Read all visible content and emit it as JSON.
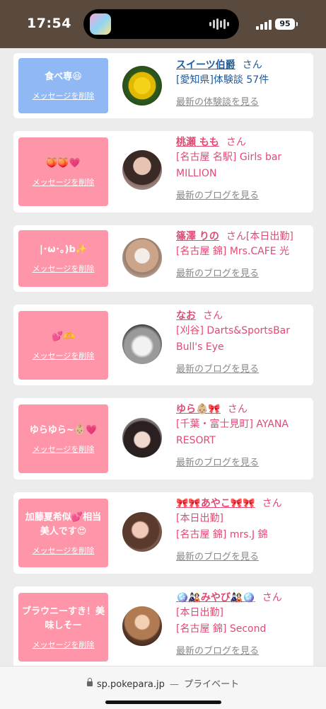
{
  "status_bar": {
    "time": "17:54",
    "battery": "95"
  },
  "cards": [
    {
      "bubble_color": "blue",
      "message": "食べ専😆",
      "delete_label": "メッセージを削除",
      "name": "スイーツ伯爵",
      "honorific": "さん",
      "name_extra": "",
      "lines": [
        "[愛知県]体験談 57件"
      ],
      "link": "最新の体験談を見る",
      "avatar": "yellow-flower"
    },
    {
      "bubble_color": "pink",
      "message": "🍑🍑💗",
      "delete_label": "メッセージを削除",
      "name": "桃瀬 もも",
      "honorific": "さん",
      "name_extra": "",
      "lines": [
        "[名古屋 名駅] Girls bar",
        "MILLION"
      ],
      "link": "最新のブログを見る",
      "avatar": "girl-dark-hair"
    },
    {
      "bubble_color": "pink",
      "message": "|･ω･｡)b✨",
      "delete_label": "メッセージを削除",
      "name": "篠澤 りの",
      "honorific": "さん",
      "name_extra": "[本日出勤]",
      "lines": [
        "[名古屋 錦] Mrs.CAFE 光"
      ],
      "link": "最新のブログを見る",
      "avatar": "girl-light-hair"
    },
    {
      "bubble_color": "pink",
      "message": "💕🫶",
      "delete_label": "メッセージを削除",
      "name": "なお",
      "honorific": "さん",
      "name_extra": "",
      "lines": [
        "[刈谷] Darts&SportsBar",
        "Bull's Eye"
      ],
      "link": "最新のブログを見る",
      "avatar": "bw-closeup"
    },
    {
      "bubble_color": "pink",
      "message": "ゆらゆら~👶🏼💗",
      "delete_label": "メッセージを削除",
      "name": "ゆら👶🏼🎀",
      "honorific": "さん",
      "name_extra": "",
      "lines": [
        "[千葉・富士見町] AYANA",
        "RESORT"
      ],
      "link": "最新のブログを見る",
      "avatar": "girl-bunny-ears"
    },
    {
      "bubble_color": "pink",
      "message": "加藤夏希似💕相当美人です😍",
      "delete_label": "メッセージを削除",
      "name": "🎀🎀あやこ🎀🎀",
      "honorific": "さん",
      "name_extra": "",
      "lines": [
        "[本日出勤]",
        "[名古屋 錦] mrs.J 錦"
      ],
      "link": "最新のブログを見る",
      "avatar": "girl-brown-hair"
    },
    {
      "bubble_color": "pink",
      "message": "ブラウニーすき！美味しそー",
      "delete_label": "メッセージを削除",
      "name": "🪩🎎みやび🎎🪩",
      "honorific": "さん",
      "name_extra": "",
      "lines": [
        "[本日出勤]",
        "[名古屋 錦] Second"
      ],
      "link": "最新のブログを見る",
      "avatar": "girl-warm-light"
    }
  ],
  "url_bar": {
    "domain": "sp.pokepara.jp",
    "separator": "—",
    "mode": "プライベート"
  }
}
